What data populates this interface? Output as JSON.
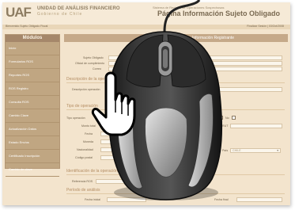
{
  "header": {
    "logo": "UAF",
    "org_line1": "UNIDAD DE ANÁLISIS FINANCIERO",
    "org_line2": "Gobierno de Chile",
    "top_caption": "Sistema de Registro de Operaciones Sospechosas",
    "page_title": "Página Información Sujeto Obligado"
  },
  "subbar": {
    "left": "Bienvenido Sujeto Obligado Fiscal",
    "right": "Finalizar Sesión | 03/Oct/2008"
  },
  "sidebar": {
    "title": "Módulos",
    "items": [
      "Inicio",
      "Formularios ROS",
      "Reportes ROS",
      "ROS Registro",
      "Consulta ROS",
      "Cambio Clave",
      "Actualización Datos",
      "Estado Envíos",
      "Certificado Inscripción",
      "Cambio de clave",
      "Cerrar sesión"
    ]
  },
  "form": {
    "header": "Información Registrante",
    "fields": {
      "sujeto": "Sujeto Obligado",
      "oficial": "Oficial de cumplimiento",
      "correo": "Correo",
      "desc_sec": "Descripción de la operación",
      "desc": "Descripción operación",
      "tipo_sec": "Tipo de operación",
      "tipo_op": "Tipo operación",
      "monto": "Monto total",
      "rut": "RUT",
      "fecha": "Fecha",
      "si": "Si",
      "no": "No",
      "moneda": "Moneda",
      "nacionalidad": "Nacionalidad",
      "cod_postal": "Código postal",
      "pais": "País",
      "pais_value": "CHILE",
      "ident_sec": "Identificación de la operación",
      "ref": "Referencia ROS",
      "period_sec": "Período de análisis",
      "fecha_inicial": "Fecha inicial",
      "fecha_final": "Fecha final"
    }
  },
  "overlay": {
    "description": "computer mouse with pointer hand cursor"
  }
}
